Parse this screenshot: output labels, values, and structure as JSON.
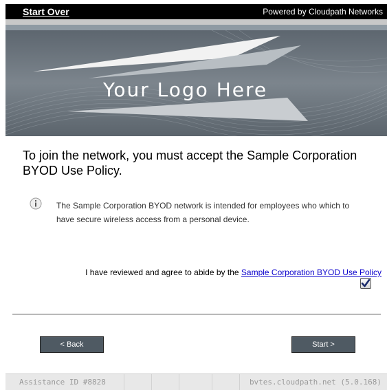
{
  "header": {
    "start_over": "Start Over",
    "powered_by": "Powered by Cloudpath Networks"
  },
  "banner": {
    "logo_text": "Your Logo Here"
  },
  "main": {
    "headline": "To join the network, you must accept the Sample Corporation BYOD Use Policy.",
    "info_text": "The Sample Corporation BYOD network is intended for employees who which to have secure wireless access from a personal device.",
    "agree_prefix": "I have reviewed and agree to abide by the",
    "policy_link": "Sample Corporation BYOD Use Policy",
    "agree_checked": true
  },
  "buttons": {
    "back": "< Back",
    "start": "Start >"
  },
  "footer": {
    "assistance": "Assistance ID #8828",
    "server": "bvtes.cloudpath.net (5.0.168)"
  },
  "colors": {
    "topbar": "#000000",
    "banner": "#6e7780",
    "button": "#4f5a63",
    "link": "#0a00cc"
  }
}
